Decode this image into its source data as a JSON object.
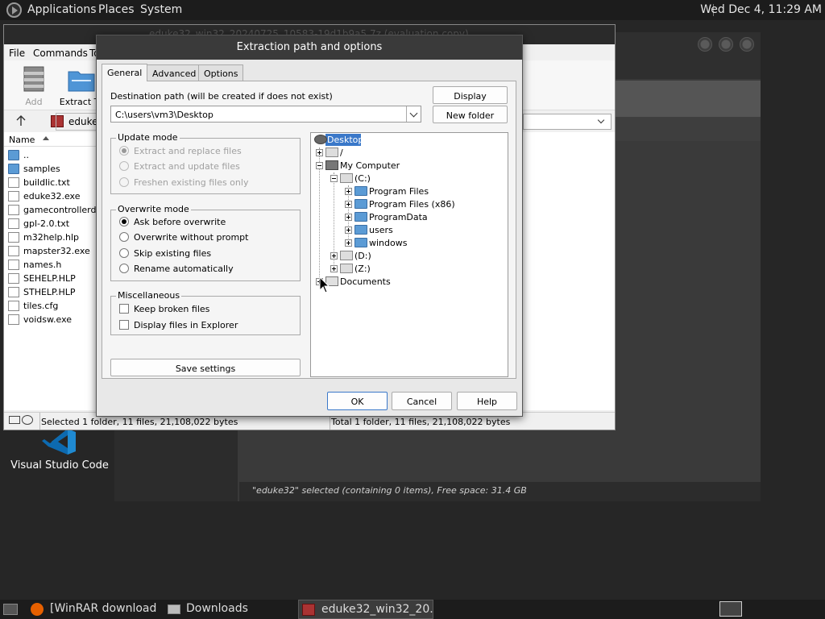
{
  "top_panel": {
    "menus": [
      "Applications",
      "Places",
      "System"
    ],
    "clock": "Wed Dec  4, 11:29 AM"
  },
  "file_manager": {
    "status": "\"eduke32\" selected (containing 0 items), Free space: 31.4 GB"
  },
  "desktop": {
    "vscode_label": "Visual Studio Code"
  },
  "winrar": {
    "title": "eduke32_win32_20240725_10583-19d1b9a5.7z (evaluation copy)",
    "menu": [
      "File",
      "Commands",
      "To"
    ],
    "tools": [
      {
        "label": "Add",
        "icon": "archive-add-icon"
      },
      {
        "label": "Extract To",
        "icon": "extract-to-icon"
      }
    ],
    "address": "eduke",
    "list_header": "Name",
    "files": [
      {
        "name": "..",
        "type": "folder"
      },
      {
        "name": "samples",
        "type": "folder"
      },
      {
        "name": "buildlic.txt",
        "type": "file"
      },
      {
        "name": "eduke32.exe",
        "type": "file"
      },
      {
        "name": "gamecontrollerd...",
        "type": "file"
      },
      {
        "name": "gpl-2.0.txt",
        "type": "file"
      },
      {
        "name": "m32help.hlp",
        "type": "file"
      },
      {
        "name": "mapster32.exe",
        "type": "file"
      },
      {
        "name": "names.h",
        "type": "file"
      },
      {
        "name": "SEHELP.HLP",
        "type": "file"
      },
      {
        "name": "STHELP.HLP",
        "type": "file"
      },
      {
        "name": "tiles.cfg",
        "type": "file"
      },
      {
        "name": "voidsw.exe",
        "type": "file"
      }
    ],
    "status_left": "Selected 1 folder, 11 files, 21,108,022 bytes",
    "status_right": "Total 1 folder, 11 files, 21,108,022 bytes"
  },
  "dialog": {
    "title": "Extraction path and options",
    "tabs": [
      "General",
      "Advanced",
      "Options"
    ],
    "dest_label": "Destination path (will be created if does not exist)",
    "dest_value": "C:\\users\\vm3\\Desktop",
    "display_button": "Display",
    "new_folder_button": "New folder",
    "update_mode": {
      "title": "Update mode",
      "options": [
        "Extract and replace files",
        "Extract and update files",
        "Freshen existing files only"
      ],
      "selected": 0,
      "disabled": true
    },
    "overwrite_mode": {
      "title": "Overwrite mode",
      "options": [
        "Ask before overwrite",
        "Overwrite without prompt",
        "Skip existing files",
        "Rename automatically"
      ],
      "selected": 0
    },
    "misc": {
      "title": "Miscellaneous",
      "options": [
        "Keep broken files",
        "Display files in Explorer"
      ]
    },
    "save_settings": "Save settings",
    "tree": [
      {
        "label": "Desktop",
        "icon": "desktop-icon",
        "selected": true
      },
      {
        "label": "/",
        "icon": "drive-icon"
      },
      {
        "label": "My Computer",
        "icon": "computer-icon"
      },
      {
        "label": "(C:)",
        "icon": "drive-icon"
      },
      {
        "label": "Program Files",
        "icon": "folder-icon"
      },
      {
        "label": "Program Files (x86)",
        "icon": "folder-icon"
      },
      {
        "label": "ProgramData",
        "icon": "folder-icon"
      },
      {
        "label": "users",
        "icon": "folder-icon"
      },
      {
        "label": "windows",
        "icon": "folder-icon"
      },
      {
        "label": "(D:)",
        "icon": "drive-icon"
      },
      {
        "label": "(Z:)",
        "icon": "drive-icon"
      },
      {
        "label": "Documents",
        "icon": "documents-icon"
      }
    ],
    "ok": "OK",
    "cancel": "Cancel",
    "help": "Help"
  },
  "taskbar": {
    "tasks": [
      "[WinRAR download ...",
      "Downloads",
      "eduke32_win32_20..."
    ]
  },
  "colors": {
    "selection": "#3a78c9",
    "folder": "#5b9bd5",
    "panel_bg": "#1c1c1c"
  }
}
